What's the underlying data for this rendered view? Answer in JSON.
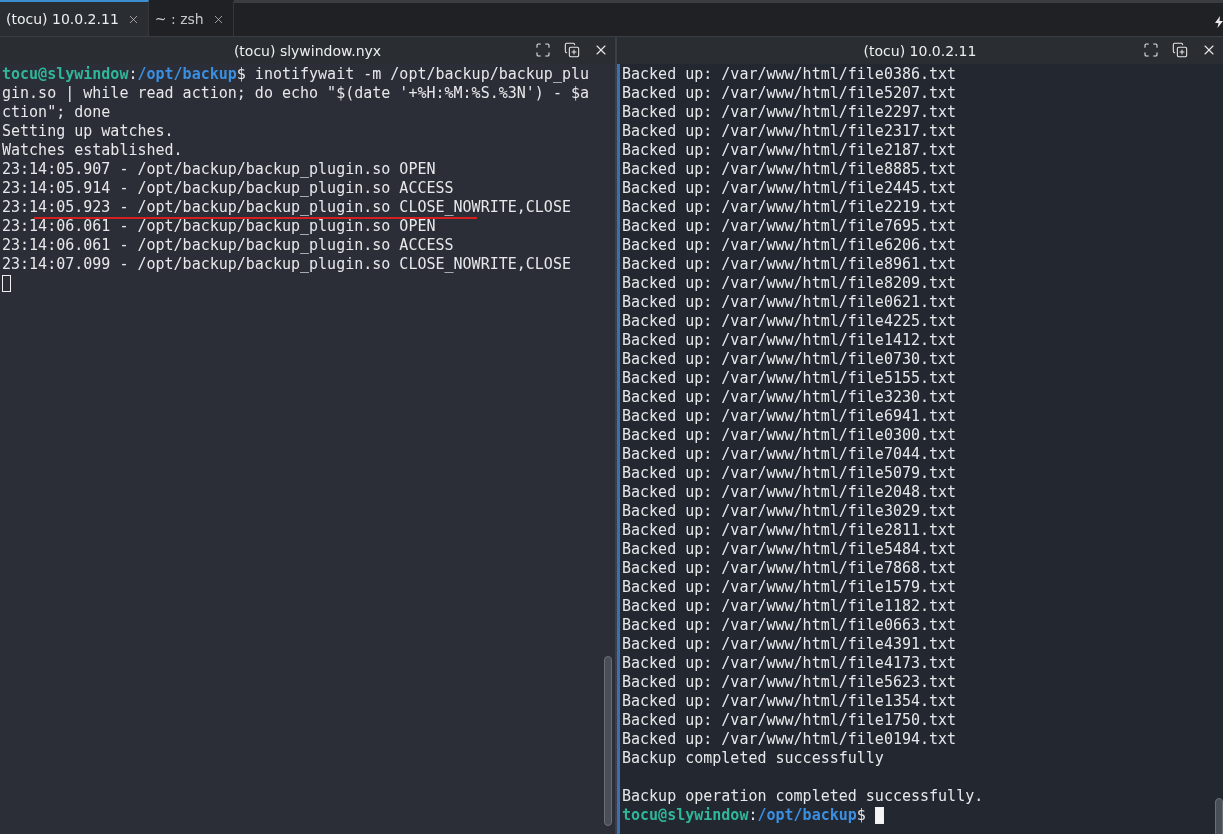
{
  "tabs": [
    {
      "label": "(tocu) 10.0.2.11",
      "selected": true
    },
    {
      "label": "~ : zsh",
      "selected": false
    }
  ],
  "panes": [
    {
      "title": "(tocu) slywindow.nyx",
      "active": false,
      "lines": [
        {
          "kind": "prompt",
          "user": "tocu@slywindow",
          "separator": ":",
          "path": "/opt/backup",
          "symbol": "$",
          "command": "inotifywait -m /opt/backup/backup_plu"
        },
        {
          "kind": "output",
          "text": "gin.so | while read action; do echo \"$(date '+%H:%M:%S.%3N') - $a"
        },
        {
          "kind": "output",
          "text": "ction\"; done"
        },
        {
          "kind": "output",
          "text": "Setting up watches."
        },
        {
          "kind": "output",
          "text": "Watches established."
        },
        {
          "kind": "output",
          "text": "23:14:05.907 - /opt/backup/backup_plugin.so OPEN"
        },
        {
          "kind": "output",
          "text": "23:14:05.914 - /opt/backup/backup_plugin.so ACCESS"
        },
        {
          "kind": "output",
          "text": "23:14:05.923 - /opt/backup/backup_plugin.so CLOSE_NOWRITE,CLOSE",
          "underlined": true
        },
        {
          "kind": "output",
          "text": "23:14:06.061 - /opt/backup/backup_plugin.so OPEN"
        },
        {
          "kind": "output",
          "text": "23:14:06.061 - /opt/backup/backup_plugin.so ACCESS"
        },
        {
          "kind": "output",
          "text": "23:14:07.099 - /opt/backup/backup_plugin.so CLOSE_NOWRITE,CLOSE"
        },
        {
          "kind": "cursor",
          "focused": false
        }
      ]
    },
    {
      "title": "(tocu) 10.0.2.11",
      "active": true,
      "lines": [
        {
          "kind": "output",
          "text": "Backed up: /var/www/html/file0386.txt"
        },
        {
          "kind": "output",
          "text": "Backed up: /var/www/html/file5207.txt"
        },
        {
          "kind": "output",
          "text": "Backed up: /var/www/html/file2297.txt"
        },
        {
          "kind": "output",
          "text": "Backed up: /var/www/html/file2317.txt"
        },
        {
          "kind": "output",
          "text": "Backed up: /var/www/html/file2187.txt"
        },
        {
          "kind": "output",
          "text": "Backed up: /var/www/html/file8885.txt"
        },
        {
          "kind": "output",
          "text": "Backed up: /var/www/html/file2445.txt"
        },
        {
          "kind": "output",
          "text": "Backed up: /var/www/html/file2219.txt"
        },
        {
          "kind": "output",
          "text": "Backed up: /var/www/html/file7695.txt"
        },
        {
          "kind": "output",
          "text": "Backed up: /var/www/html/file6206.txt"
        },
        {
          "kind": "output",
          "text": "Backed up: /var/www/html/file8961.txt"
        },
        {
          "kind": "output",
          "text": "Backed up: /var/www/html/file8209.txt"
        },
        {
          "kind": "output",
          "text": "Backed up: /var/www/html/file0621.txt"
        },
        {
          "kind": "output",
          "text": "Backed up: /var/www/html/file4225.txt"
        },
        {
          "kind": "output",
          "text": "Backed up: /var/www/html/file1412.txt"
        },
        {
          "kind": "output",
          "text": "Backed up: /var/www/html/file0730.txt"
        },
        {
          "kind": "output",
          "text": "Backed up: /var/www/html/file5155.txt"
        },
        {
          "kind": "output",
          "text": "Backed up: /var/www/html/file3230.txt"
        },
        {
          "kind": "output",
          "text": "Backed up: /var/www/html/file6941.txt"
        },
        {
          "kind": "output",
          "text": "Backed up: /var/www/html/file0300.txt"
        },
        {
          "kind": "output",
          "text": "Backed up: /var/www/html/file7044.txt"
        },
        {
          "kind": "output",
          "text": "Backed up: /var/www/html/file5079.txt"
        },
        {
          "kind": "output",
          "text": "Backed up: /var/www/html/file2048.txt"
        },
        {
          "kind": "output",
          "text": "Backed up: /var/www/html/file3029.txt"
        },
        {
          "kind": "output",
          "text": "Backed up: /var/www/html/file2811.txt"
        },
        {
          "kind": "output",
          "text": "Backed up: /var/www/html/file5484.txt"
        },
        {
          "kind": "output",
          "text": "Backed up: /var/www/html/file7868.txt"
        },
        {
          "kind": "output",
          "text": "Backed up: /var/www/html/file1579.txt"
        },
        {
          "kind": "output",
          "text": "Backed up: /var/www/html/file1182.txt"
        },
        {
          "kind": "output",
          "text": "Backed up: /var/www/html/file0663.txt"
        },
        {
          "kind": "output",
          "text": "Backed up: /var/www/html/file4391.txt"
        },
        {
          "kind": "output",
          "text": "Backed up: /var/www/html/file4173.txt"
        },
        {
          "kind": "output",
          "text": "Backed up: /var/www/html/file5623.txt"
        },
        {
          "kind": "output",
          "text": "Backed up: /var/www/html/file1354.txt"
        },
        {
          "kind": "output",
          "text": "Backed up: /var/www/html/file1750.txt"
        },
        {
          "kind": "output",
          "text": "Backed up: /var/www/html/file0194.txt"
        },
        {
          "kind": "output",
          "text": "Backup completed successfully"
        },
        {
          "kind": "blank"
        },
        {
          "kind": "output",
          "text": "Backup operation completed successfully."
        },
        {
          "kind": "prompt",
          "user": "tocu@slywindow",
          "separator": ":",
          "path": "/opt/backup",
          "symbol": "$",
          "cursor": true,
          "focused": true
        }
      ]
    }
  ]
}
